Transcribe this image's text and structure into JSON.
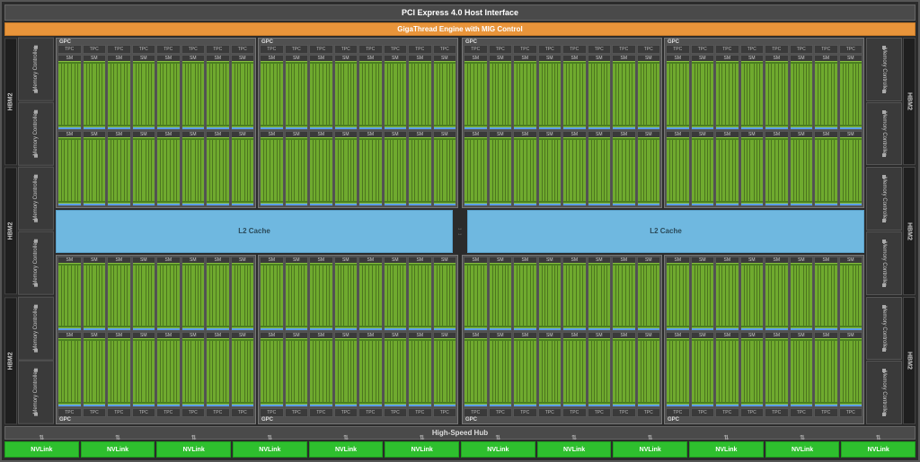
{
  "top_interface": "PCI Express 4.0 Host Interface",
  "gigathread": "GigaThread Engine with MIG Control",
  "gpc_label": "GPC",
  "tpc_label": "TPC",
  "sm_label": "SM",
  "l2_label": "L2 Cache",
  "hbm_label": "HBM2",
  "mc_label": "Memory Controller",
  "high_speed_hub": "High-Speed Hub",
  "nvlink_label": "NVLink",
  "structure": {
    "gpc_count": 8,
    "tpc_per_gpc": 8,
    "sm_rows_per_gpc": 2,
    "sm_per_row": 8,
    "hbm_stacks_per_side": 3,
    "mc_per_hbm": 2,
    "nvlink_count": 12,
    "l2_cache_blocks": 2
  },
  "colors": {
    "frame": "#2b2b2b",
    "gigathread": "#e8943a",
    "sm_core": "#6faa2e",
    "l2": "#6fb8e0",
    "nvlink": "#2ebf2e",
    "memory": "#3a3a3a"
  }
}
